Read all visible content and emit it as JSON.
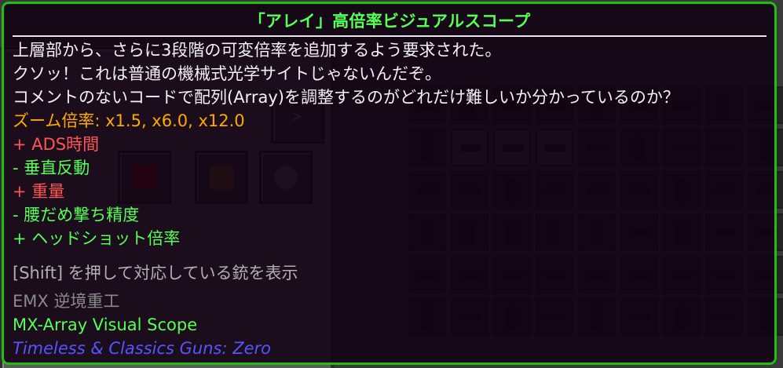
{
  "tooltip": {
    "title": "「アレイ」高倍率ビジュアルスコープ",
    "description": [
      "上層部から、さらに3段階の可変倍率を追加するよう要求された。",
      "クソッ！これは普通の機械式光学サイトじゃないんだぞ。",
      "コメントのないコードで配列(Array)を調整するのがどれだけ難しいか分かっているのか？"
    ],
    "zoom": "ズーム倍率: x1.5, x6.0, x12.0",
    "stats": [
      {
        "text": "+ ADS時間",
        "color": "red"
      },
      {
        "text": "- 垂直反動",
        "color": "green"
      },
      {
        "text": "+ 重量",
        "color": "red"
      },
      {
        "text": "- 腰だめ撃ち精度",
        "color": "green"
      },
      {
        "text": "+ ヘッドショット倍率",
        "color": "green"
      }
    ],
    "shift_hint": "[Shift] を押して対応している銃を表示",
    "manufacturer": "EMX 逆境重工",
    "item_id": "MX-Array Visual Scope",
    "mod_name": "Timeless & Classics Guns: Zero"
  },
  "colors": {
    "border": "#1fbf0f",
    "title": "#55ff55",
    "gold": "#ffaa00",
    "red": "#ff5555",
    "green": "#55ff55",
    "blue": "#5555ff"
  },
  "background": {
    "slot_label": ">"
  }
}
